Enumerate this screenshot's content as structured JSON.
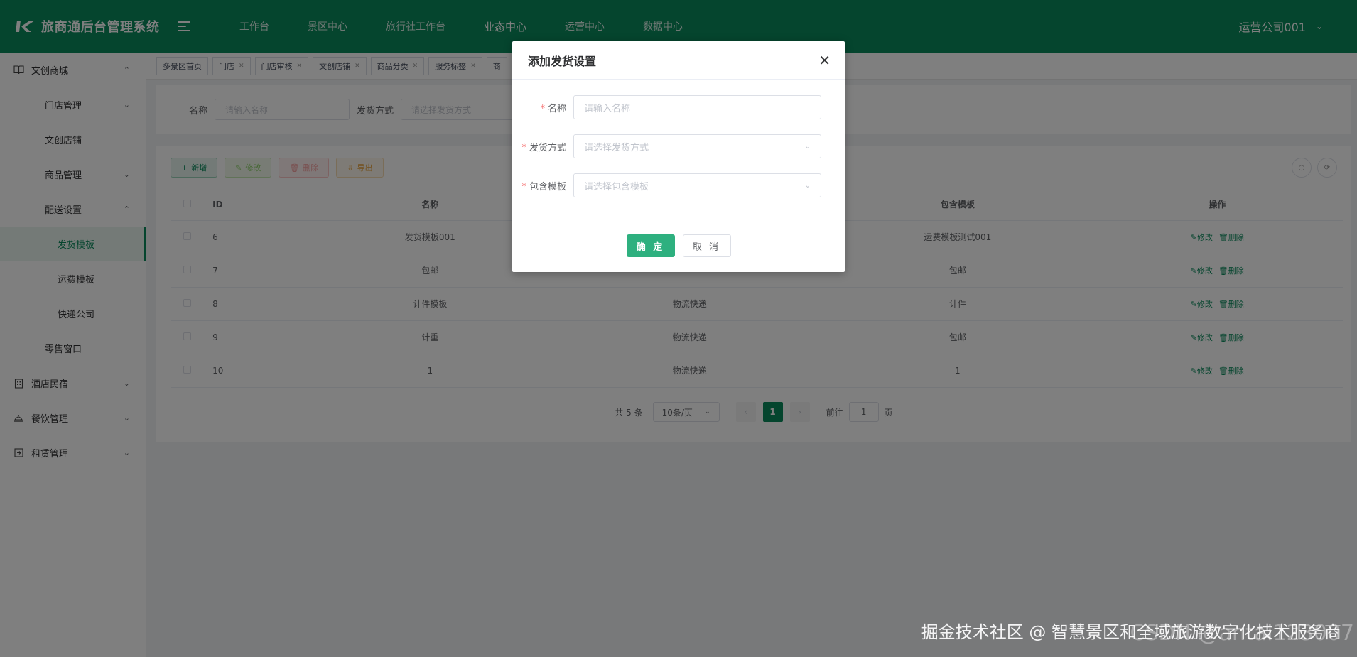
{
  "header": {
    "app_title": "旅商通后台管理系统",
    "nav": [
      "工作台",
      "景区中心",
      "旅行社工作台",
      "业态中心",
      "运营中心",
      "数据中心"
    ],
    "active_nav": "业态中心",
    "user": "运营公司001"
  },
  "sidebar": {
    "items": [
      {
        "label": "文创商城",
        "level": 1,
        "icon": "book-icon",
        "arrow": "up"
      },
      {
        "label": "门店管理",
        "level": 2,
        "arrow": "down"
      },
      {
        "label": "文创店铺",
        "level": 2
      },
      {
        "label": "商品管理",
        "level": 2,
        "arrow": "down"
      },
      {
        "label": "配送设置",
        "level": 2,
        "arrow": "up"
      },
      {
        "label": "发货模板",
        "level": 3,
        "selected": true
      },
      {
        "label": "运费模板",
        "level": 3
      },
      {
        "label": "快递公司",
        "level": 3
      },
      {
        "label": "零售窗口",
        "level": 2
      },
      {
        "label": "酒店民宿",
        "level": 1,
        "icon": "building-icon",
        "arrow": "down"
      },
      {
        "label": "餐饮管理",
        "level": 1,
        "icon": "dish-icon",
        "arrow": "down"
      },
      {
        "label": "租赁管理",
        "level": 1,
        "icon": "rental-icon",
        "arrow": "down"
      }
    ]
  },
  "tags": [
    "多景区首页",
    "门店",
    "门店审核",
    "文创店铺",
    "商品分类",
    "服务标签",
    "商"
  ],
  "search": {
    "name_label": "名称",
    "name_placeholder": "请输入名称",
    "method_label": "发货方式",
    "method_placeholder": "请选择发货方式"
  },
  "toolbar": {
    "add": "新增",
    "edit": "修改",
    "delete": "删除",
    "export": "导出"
  },
  "table": {
    "columns": [
      "ID",
      "名称",
      "",
      "包含模板",
      "操作"
    ],
    "rows": [
      {
        "id": "6",
        "name": "发货模板001",
        "method": "",
        "template": "运费模板测试001"
      },
      {
        "id": "7",
        "name": "包邮",
        "method": "",
        "template": "包邮"
      },
      {
        "id": "8",
        "name": "计件模板",
        "method": "物流快递",
        "template": "计件"
      },
      {
        "id": "9",
        "name": "计重",
        "method": "物流快递",
        "template": "包邮"
      },
      {
        "id": "10",
        "name": "1",
        "method": "物流快递",
        "template": "1"
      }
    ],
    "op_edit": "修改",
    "op_delete": "删除"
  },
  "pagination": {
    "total": "共 5 条",
    "page_size": "10条/页",
    "current_page": "1",
    "goto_label": "前往",
    "goto_value": "1",
    "page_suffix": "页"
  },
  "dialog": {
    "title": "添加发货设置",
    "fields": [
      {
        "label": "名称",
        "placeholder": "请输入名称",
        "type": "input"
      },
      {
        "label": "发货方式",
        "placeholder": "请选择发货方式",
        "type": "select"
      },
      {
        "label": "包含模板",
        "placeholder": "请选择包含模板",
        "type": "select"
      }
    ],
    "confirm": "确 定",
    "cancel": "取 消"
  },
  "watermark": {
    "text": "掘金技术社区 @ 智慧景区和全域旅游数字化技术服务商",
    "text_bg": "CSDN @antai123007"
  },
  "colors": {
    "brand": "#0a8a5c",
    "confirm": "#2eb07f",
    "required": "#f56c6c"
  }
}
